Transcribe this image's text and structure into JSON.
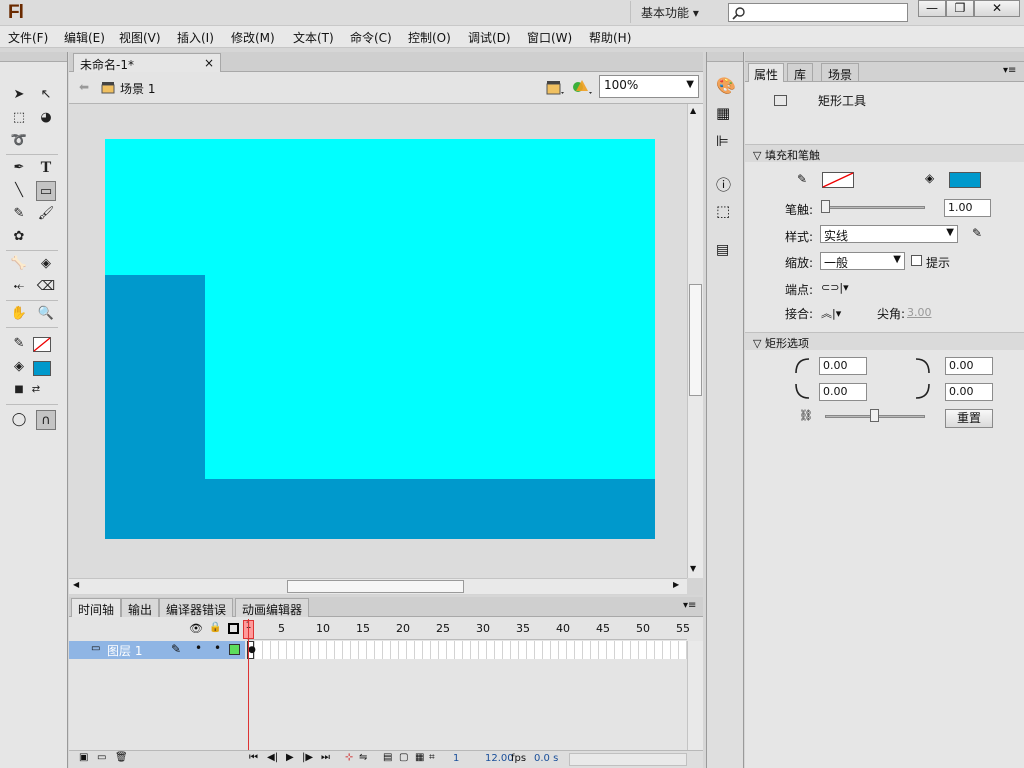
{
  "app": {
    "logo": "Fl",
    "workspace": "基本功能",
    "workspace_caret": "▾",
    "search_placeholder": ""
  },
  "window_buttons": {
    "min": "—",
    "max": "❐",
    "close": "✕"
  },
  "menu": [
    "文件(F)",
    "编辑(E)",
    "视图(V)",
    "插入(I)",
    "修改(M)",
    "文本(T)",
    "命令(C)",
    "控制(O)",
    "调试(D)",
    "窗口(W)",
    "帮助(H)"
  ],
  "document": {
    "tab": "未命名-1*",
    "tab_close": "×",
    "scene": "场景 1",
    "zoom": "100%",
    "colors": {
      "stage": "#00ffff",
      "fill": "#0099cc"
    }
  },
  "timeline": {
    "tabs": [
      "时间轴",
      "输出",
      "编译器错误",
      "动画编辑器"
    ],
    "layer_name": "图层 1",
    "ruler": [
      "1",
      "5",
      "10",
      "15",
      "20",
      "25",
      "30",
      "35",
      "40",
      "45",
      "50",
      "55"
    ],
    "current_frame": "1",
    "fps": "12.00",
    "fps_unit": "fps",
    "time": "0.0 s"
  },
  "properties": {
    "tabs": [
      "属性",
      "库",
      "场景"
    ],
    "tool_name": "矩形工具",
    "fill_stroke": {
      "section": "填充和笔触",
      "stroke_label": "笔触:",
      "stroke_value": "1.00",
      "style_label": "样式:",
      "style_value": "实线",
      "scale_label": "缩放:",
      "scale_value": "一般",
      "hint_label": "提示",
      "cap_label": "端点:",
      "join_label": "接合:",
      "miter_label": "尖角:",
      "miter_value": "3.00",
      "fill_color": "#0099cc",
      "stroke_color": "none"
    },
    "rect_options": {
      "section": "矩形选项",
      "tl": "0.00",
      "tr": "0.00",
      "bl": "0.00",
      "br": "0.00",
      "reset": "重置"
    }
  }
}
